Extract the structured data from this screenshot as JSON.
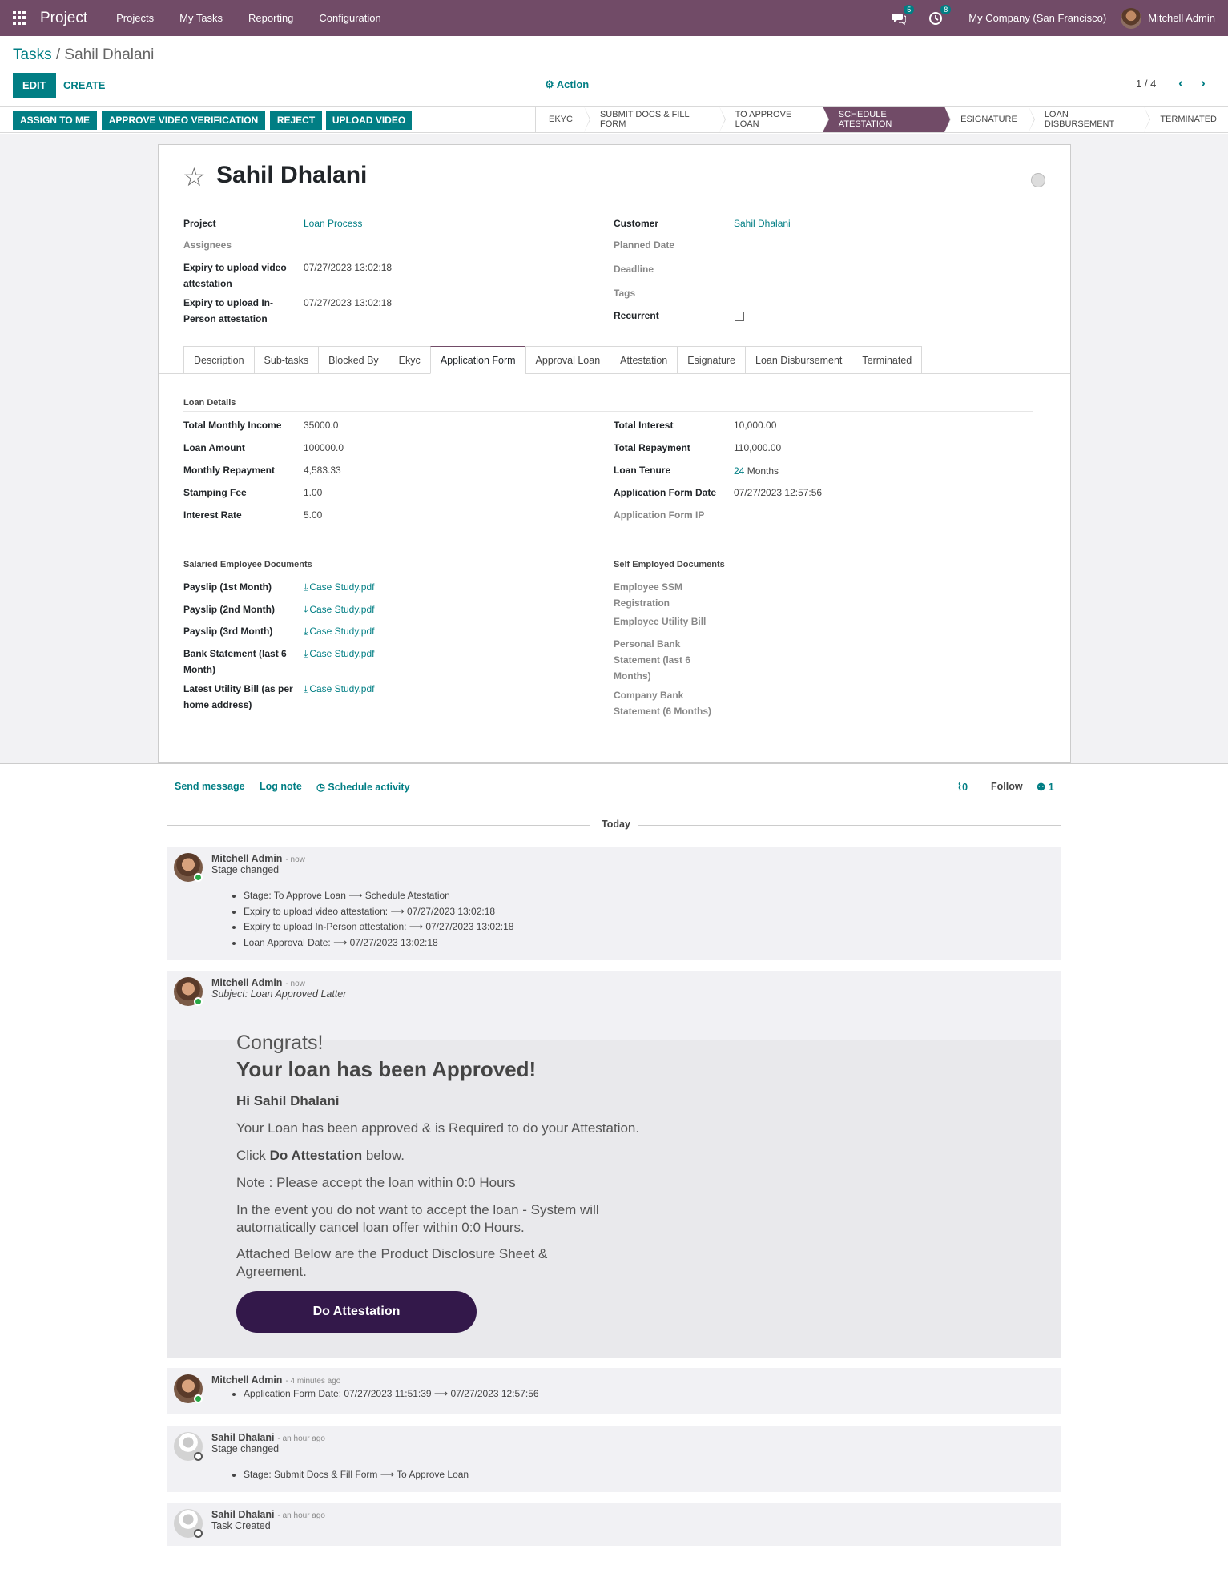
{
  "navbar": {
    "app_name": "Project",
    "menu": [
      "Projects",
      "My Tasks",
      "Reporting",
      "Configuration"
    ],
    "messages_badge": "5",
    "activities_badge": "8",
    "company": "My Company (San Francisco)",
    "user": "Mitchell Admin"
  },
  "breadcrumb": {
    "parent": "Tasks",
    "separator": " / ",
    "current": "Sahil Dhalani"
  },
  "controls": {
    "edit": "EDIT",
    "create": "CREATE",
    "action": "⚙ Action",
    "pager": "1 / 4"
  },
  "header_buttons": [
    "ASSIGN TO ME",
    "APPROVE VIDEO VERIFICATION",
    "REJECT",
    "UPLOAD VIDEO"
  ],
  "stages": {
    "items": [
      "EKYC",
      "SUBMIT DOCS & FILL FORM",
      "TO APPROVE LOAN",
      "SCHEDULE ATESTATION",
      "ESIGNATURE",
      "LOAN DISBURSEMENT",
      "TERMINATED"
    ],
    "active_index": 3
  },
  "task": {
    "title": "Sahil Dhalani",
    "left_fields": [
      {
        "label": "Project",
        "value": "Loan Process"
      },
      {
        "label": "Assignees",
        "value": ""
      },
      {
        "label": "Expiry to upload video attestation",
        "value": "07/27/2023 13:02:18"
      },
      {
        "label": "Expiry to upload In-Person attestation",
        "value": "07/27/2023 13:02:18"
      }
    ],
    "right_fields": [
      {
        "label": "Customer",
        "value": "Sahil Dhalani"
      },
      {
        "label": "Planned Date",
        "value": ""
      },
      {
        "label": "Deadline",
        "value": ""
      },
      {
        "label": "Tags",
        "value": ""
      },
      {
        "label": "Recurrent",
        "value": ""
      }
    ]
  },
  "tabs": {
    "items": [
      "Description",
      "Sub-tasks",
      "Blocked By",
      "Ekyc",
      "Application Form",
      "Approval Loan",
      "Attestation",
      "Esignature",
      "Loan Disbursement",
      "Terminated"
    ],
    "active_index": 4
  },
  "loan_details": {
    "title": "Loan Details",
    "left": [
      {
        "label": "Total Monthly Income",
        "value": "35000.0"
      },
      {
        "label": "Loan Amount",
        "value": "100000.0"
      },
      {
        "label": "Monthly Repayment",
        "value": "4,583.33"
      },
      {
        "label": "Stamping Fee",
        "value": "1.00"
      },
      {
        "label": "Interest Rate",
        "value": "5.00"
      }
    ],
    "right": [
      {
        "label": "Total Interest",
        "value": "10,000.00"
      },
      {
        "label": "Total Repayment",
        "value": "110,000.00"
      },
      {
        "label": "Loan Tenure",
        "value_num": "24",
        "value_unit": " Months"
      },
      {
        "label": "Application Form Date",
        "value": "07/27/2023 12:57:56"
      },
      {
        "label": "Application Form IP",
        "value": ""
      }
    ]
  },
  "salaried_docs": {
    "title": "Salaried Employee Documents",
    "items": [
      {
        "label": "Payslip (1st Month)",
        "file": "Case Study.pdf"
      },
      {
        "label": "Payslip (2nd Month)",
        "file": "Case Study.pdf"
      },
      {
        "label": "Payslip (3rd Month)",
        "file": "Case Study.pdf"
      },
      {
        "label": "Bank Statement (last 6 Month)",
        "file": "Case Study.pdf"
      },
      {
        "label": "Latest Utility Bill (as per home address)",
        "file": "Case Study.pdf"
      }
    ]
  },
  "self_employed_docs": {
    "title": "Self Employed Documents",
    "items": [
      "Employee SSM Registration",
      "Employee Utility Bill",
      "Personal Bank Statement (last 6 Months)",
      "Company Bank Statement (6 Months)"
    ]
  },
  "chatter": {
    "send_message": "Send message",
    "log_note": "Log note",
    "schedule_activity": "Schedule activity",
    "attachments_count": "0",
    "follow": "Follow",
    "followers_count": "1",
    "today": "Today"
  },
  "messages": [
    {
      "author": "Mitchell Admin",
      "time": "- now",
      "text": "Stage changed",
      "changes": [
        "Stage: To Approve Loan ⟶ Schedule Atestation",
        "Expiry to upload video attestation: ⟶ 07/27/2023 13:02:18",
        "Expiry to upload In-Person attestation: ⟶ 07/27/2023 13:02:18",
        "Loan Approval Date: ⟶ 07/27/2023 13:02:18"
      ]
    },
    {
      "author": "Mitchell Admin",
      "time": "- now",
      "subject": "Subject: Loan Approved Latter",
      "email": {
        "congrats": "Congrats!",
        "heading": "Your loan has been Approved!",
        "greeting": "Hi Sahil Dhalani",
        "line1": "Your Loan has been approved & is Required to do your Attestation.",
        "line2_pre": "Click ",
        "line2_bold": "Do Attestation",
        "line2_post": " below.",
        "line3": "Note : Please accept the loan within 0:0 Hours",
        "line4a": "In the event you do not want to accept the loan - System will",
        "line4b": "automatically cancel loan offer within 0:0 Hours.",
        "line5a": "Attached Below are the Product Disclosure Sheet &",
        "line5b": "Agreement.",
        "button": "Do Attestation"
      }
    },
    {
      "author": "Mitchell Admin",
      "time": "- 4 minutes ago",
      "changes": [
        "Application Form Date: 07/27/2023 11:51:39 ⟶ 07/27/2023 12:57:56"
      ]
    },
    {
      "author": "Sahil Dhalani",
      "time": "- an hour ago",
      "text": "Stage changed",
      "changes": [
        "Stage: Submit Docs & Fill Form ⟶ To Approve Loan"
      ]
    },
    {
      "author": "Sahil Dhalani",
      "time": "- an hour ago",
      "text": "Task Created"
    }
  ],
  "colors": {
    "brand": "#714b67",
    "accent": "#017e84",
    "button_dark": "#33184a"
  }
}
